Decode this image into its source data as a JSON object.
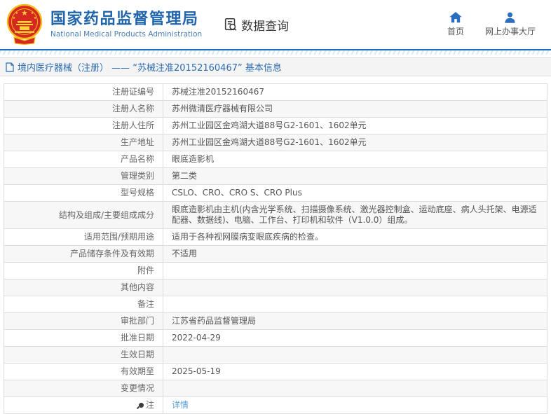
{
  "header": {
    "org_name_zh": "国家药品监督管理局",
    "org_name_en": "National Medical Products Administration",
    "module_label": "数据查询",
    "nav": [
      {
        "label": "首页",
        "icon": "home-icon"
      },
      {
        "label": "网上办事大厅",
        "icon": "user-icon"
      }
    ]
  },
  "breadcrumb": {
    "text": "境内医疗器械（注册） —— “苏械注准20152160467” 基本信息"
  },
  "detail_table": {
    "rows": [
      {
        "label": "注册证编号",
        "value": "苏械注准20152160467"
      },
      {
        "label": "注册人名称",
        "value": "苏州微清医疗器械有限公司"
      },
      {
        "label": "注册人住所",
        "value": "苏州工业园区金鸡湖大道88号G2-1601、1602单元"
      },
      {
        "label": "生产地址",
        "value": "苏州工业园区金鸡湖大道88号G2-1601、1602单元"
      },
      {
        "label": "产品名称",
        "value": "眼底造影机"
      },
      {
        "label": "管理类别",
        "value": "第二类"
      },
      {
        "label": "型号规格",
        "value": "CSLO、CRO、CRO S、CRO Plus"
      },
      {
        "label": "结构及组成/主要组成成分",
        "value": "眼底造影机由主机(内含光学系统、扫描摄像系统、激光器控制盒、运动底座、病人头托架、电源适配器、数据线)、电脑、工作台、打印机和软件（V1.0.0）组成。"
      },
      {
        "label": "适用范围/预期用途",
        "value": "适用于各种视网膜病变眼底疾病的检查。"
      },
      {
        "label": "产品储存条件及有效期",
        "value": "不适用"
      },
      {
        "label": "附件",
        "value": ""
      },
      {
        "label": "其他内容",
        "value": ""
      },
      {
        "label": "备注",
        "value": ""
      },
      {
        "label": "审批部门",
        "value": "江苏省药品监督管理局"
      },
      {
        "label": "批准日期",
        "value": "2022-04-29"
      },
      {
        "label": "生效日期",
        "value": ""
      },
      {
        "label": "有效期至",
        "value": "2025-05-19"
      },
      {
        "label": "变更情况",
        "value": ""
      },
      {
        "label": "注",
        "value": "详情",
        "link": true,
        "icon": "pin-icon"
      }
    ]
  },
  "colors": {
    "brand_blue": "#2166ad",
    "icon_blue": "#2b6fc0",
    "link_blue": "#5a9ed8",
    "emblem_red": "#d5281e",
    "emblem_gold": "#f2bc1e",
    "row_alt_bg": "#f7f7f7",
    "border_gray": "#dddddd"
  }
}
